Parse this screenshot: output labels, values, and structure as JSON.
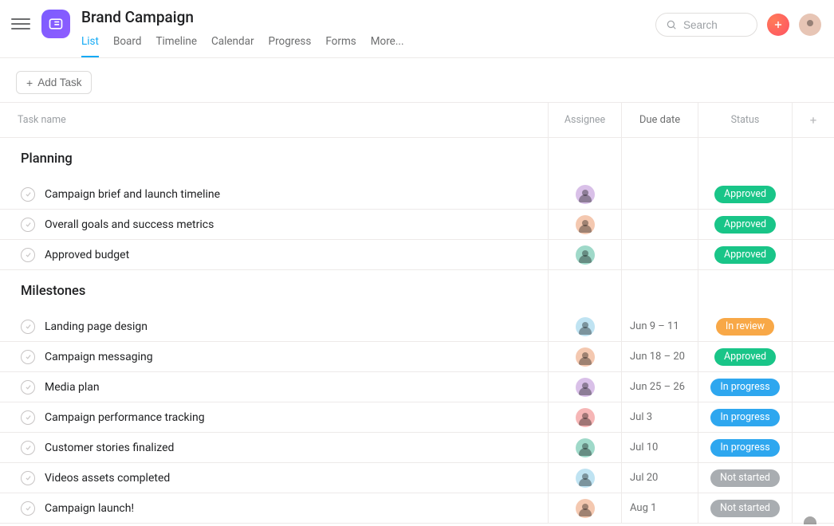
{
  "header": {
    "project_title": "Brand Campaign",
    "tabs": [
      {
        "label": "List",
        "active": true
      },
      {
        "label": "Board"
      },
      {
        "label": "Timeline"
      },
      {
        "label": "Calendar"
      },
      {
        "label": "Progress"
      },
      {
        "label": "Forms"
      },
      {
        "label": "More..."
      }
    ],
    "search_placeholder": "Search"
  },
  "toolbar": {
    "add_task_label": "Add Task"
  },
  "columns": {
    "name": "Task name",
    "assignee": "Assignee",
    "due": "Due date",
    "status": "Status"
  },
  "avatar_colors": {
    "a": "#d9c0e8",
    "b": "#f4c8b0",
    "c": "#9fd9c9",
    "d": "#bfe3f2",
    "e": "#f6b6b6"
  },
  "statuses": {
    "approved": {
      "label": "Approved",
      "class": "status-approved"
    },
    "inreview": {
      "label": "In review",
      "class": "status-inreview"
    },
    "inprogress": {
      "label": "In progress",
      "class": "status-inprogress"
    },
    "notstarted": {
      "label": "Not started",
      "class": "status-notstarted"
    }
  },
  "sections": [
    {
      "title": "Planning",
      "tasks": [
        {
          "name": "Campaign brief and launch timeline",
          "assignee": "a",
          "due": "",
          "status": "approved"
        },
        {
          "name": "Overall goals and success metrics",
          "assignee": "b",
          "due": "",
          "status": "approved"
        },
        {
          "name": "Approved budget",
          "assignee": "c",
          "due": "",
          "status": "approved"
        }
      ]
    },
    {
      "title": "Milestones",
      "tasks": [
        {
          "name": "Landing page design",
          "assignee": "d",
          "due": "Jun 9 – 11",
          "status": "inreview"
        },
        {
          "name": "Campaign messaging",
          "assignee": "b",
          "due": "Jun 18 – 20",
          "status": "approved"
        },
        {
          "name": "Media plan",
          "assignee": "a",
          "due": "Jun 25 – 26",
          "status": "inprogress"
        },
        {
          "name": "Campaign performance tracking",
          "assignee": "e",
          "due": "Jul 3",
          "status": "inprogress"
        },
        {
          "name": "Customer stories finalized",
          "assignee": "c",
          "due": "Jul 10",
          "status": "inprogress"
        },
        {
          "name": "Videos assets completed",
          "assignee": "d",
          "due": "Jul 20",
          "status": "notstarted"
        },
        {
          "name": "Campaign launch!",
          "assignee": "b",
          "due": "Aug 1",
          "status": "notstarted"
        }
      ]
    }
  ]
}
